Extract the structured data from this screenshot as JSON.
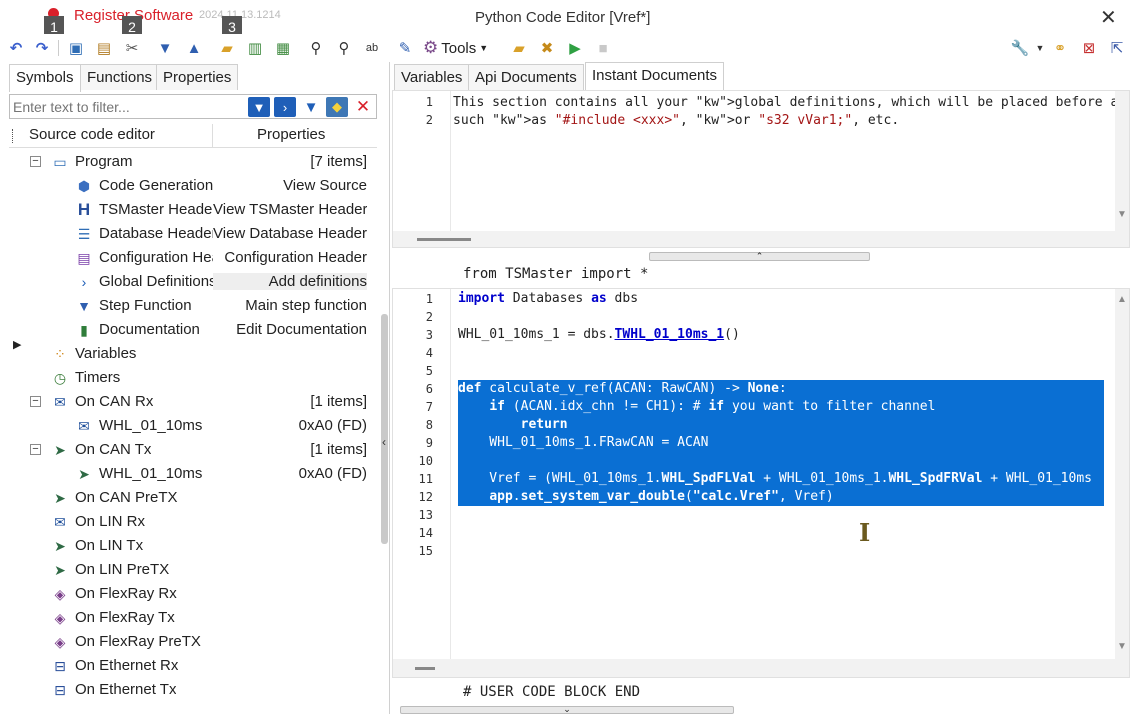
{
  "titlebar": {
    "register_label": "Register Software",
    "date": "2024.11.13.1214",
    "title": "Python Code Editor [Vref*]",
    "close_glyph": "✕",
    "badges": [
      "1",
      "2",
      "3"
    ]
  },
  "toolbar": {
    "tools_label": "Tools",
    "icons": [
      "undo-icon",
      "redo-icon",
      "copy-icon",
      "paste-icon",
      "cut-icon",
      "move-down-icon",
      "move-up-icon",
      "open-folder-icon",
      "save-icon",
      "save-as-icon",
      "search-icon",
      "search-replace-icon",
      "replace-text-icon",
      "edit-pen-icon",
      "gear-icon",
      "folder-icon",
      "clear-icon",
      "run-icon",
      "stop-icon",
      "wrench-icon",
      "link-icon",
      "close-doc-icon",
      "export-icon"
    ]
  },
  "left_panel": {
    "tabs": [
      "Symbols",
      "Functions",
      "Properties"
    ],
    "active_tab": "Symbols",
    "filter_placeholder": "Enter text to filter...",
    "tree_header": {
      "col1": "Source code editor",
      "col2": "Properties"
    },
    "tree": [
      {
        "label": "Program",
        "value": "[7 items]",
        "level": 1,
        "expander": "−",
        "icon": "program-window-icon"
      },
      {
        "label": "Code Generation",
        "value": "View Source",
        "level": 2,
        "icon": "code-generation-icon"
      },
      {
        "label": "TSMaster Header",
        "value": "View TSMaster Header",
        "level": 2,
        "icon": "header-h-icon"
      },
      {
        "label": "Database Header",
        "value": "View Database Header",
        "level": 2,
        "icon": "database-icon"
      },
      {
        "label": "Configuration Header",
        "value": "Configuration Header",
        "level": 2,
        "icon": "configuration-icon"
      },
      {
        "label": "Global Definitions",
        "value": "Add definitions",
        "level": 2,
        "icon": "global-definitions-icon",
        "selected": true
      },
      {
        "label": "Step Function",
        "value": "Main step function",
        "level": 2,
        "icon": "step-function-icon"
      },
      {
        "label": "Documentation",
        "value": "Edit Documentation",
        "level": 2,
        "icon": "documentation-book-icon"
      },
      {
        "label": "Variables",
        "value": "",
        "level": 1,
        "icon": "variables-icon"
      },
      {
        "label": "Timers",
        "value": "",
        "level": 1,
        "icon": "timer-clock-icon"
      },
      {
        "label": "On CAN Rx",
        "value": "[1 items]",
        "level": 1,
        "expander": "−",
        "icon": "envelope-icon"
      },
      {
        "label": "WHL_01_10ms",
        "value": "0xA0 (FD)",
        "level": 2,
        "icon": "envelope-icon"
      },
      {
        "label": "On CAN Tx",
        "value": "[1 items]",
        "level": 1,
        "expander": "−",
        "icon": "send-plane-icon"
      },
      {
        "label": "WHL_01_10ms",
        "value": "0xA0 (FD)",
        "level": 2,
        "icon": "send-plane-icon"
      },
      {
        "label": "On CAN PreTX",
        "value": "",
        "level": 1,
        "icon": "send-plane-icon"
      },
      {
        "label": "On LIN Rx",
        "value": "",
        "level": 1,
        "icon": "envelope-icon"
      },
      {
        "label": "On LIN Tx",
        "value": "",
        "level": 1,
        "icon": "send-plane-icon"
      },
      {
        "label": "On LIN PreTX",
        "value": "",
        "level": 1,
        "icon": "send-plane-icon"
      },
      {
        "label": "On FlexRay Rx",
        "value": "",
        "level": 1,
        "icon": "flexray-icon"
      },
      {
        "label": "On FlexRay Tx",
        "value": "",
        "level": 1,
        "icon": "flexray-icon"
      },
      {
        "label": "On FlexRay PreTX",
        "value": "",
        "level": 1,
        "icon": "flexray-icon"
      },
      {
        "label": "On Ethernet Rx",
        "value": "",
        "level": 1,
        "icon": "ethernet-icon"
      },
      {
        "label": "On Ethernet Tx",
        "value": "",
        "level": 1,
        "icon": "ethernet-icon"
      }
    ]
  },
  "right_panel": {
    "tabs": [
      "Variables",
      "Api Documents",
      "Instant Documents"
    ],
    "active_tab": "Instant Documents",
    "top_editor": {
      "line_numbers": [
        "1",
        "2"
      ],
      "lines": [
        "This section contains all your global definitions, which will be placed before al",
        "such as \"#include <xxx>\", or \"s32 vVar1;\", etc."
      ]
    },
    "fixed_header": "from TSMaster import *",
    "main_editor": {
      "line_numbers": [
        "1",
        "2",
        "3",
        "4",
        "5",
        "6",
        "7",
        "8",
        "9",
        "10",
        "11",
        "12",
        "13",
        "14",
        "15"
      ],
      "lines": [
        "import Databases as dbs",
        "",
        "WHL_01_10ms_1 = dbs.TWHL_01_10ms_1()",
        "",
        "",
        "def calculate_v_ref(ACAN: RawCAN) -> None:",
        "    if (ACAN.idx_chn != CH1): # if you want to filter channel",
        "        return",
        "    WHL_01_10ms_1.FRawCAN = ACAN",
        "",
        "    Vref = (WHL_01_10ms_1.WHL_SpdFLVal + WHL_01_10ms_1.WHL_SpdFRVal + WHL_01_10ms",
        "    app.set_system_var_double(\"calc.Vref\", Vref)",
        "",
        "",
        ""
      ],
      "selected_lines": [
        6,
        7,
        8,
        9,
        10,
        11,
        12
      ]
    },
    "fixed_footer": "# USER CODE BLOCK END"
  },
  "colors": {
    "accent_red": "#d9202a",
    "selection_blue": "#0a6fd3",
    "keyword_blue": "#0000cc",
    "string_red": "#a31515"
  }
}
